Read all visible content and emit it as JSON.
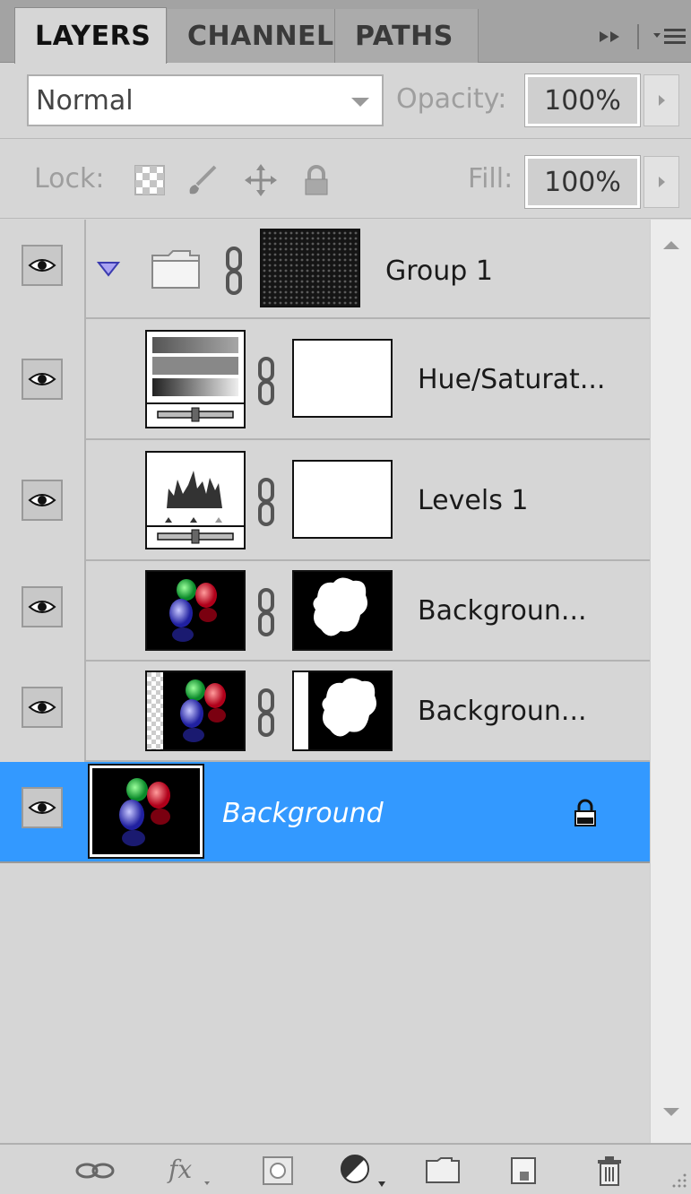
{
  "tabs": [
    {
      "label": "LAYERS",
      "active": true
    },
    {
      "label": "CHANNEL",
      "active": false
    },
    {
      "label": "PATHS",
      "active": false
    }
  ],
  "blend": {
    "mode": "Normal",
    "opacity_label": "Opacity:",
    "opacity_value": "100%"
  },
  "lock": {
    "label": "Lock:",
    "fill_label": "Fill:",
    "fill_value": "100%",
    "icons": [
      "transparency-lock-icon",
      "brush-lock-icon",
      "move-lock-icon",
      "padlock-icon"
    ]
  },
  "layers": [
    {
      "name": "Group 1",
      "type": "group",
      "expanded": true,
      "visible": true
    },
    {
      "name": "Hue/Saturat...",
      "type": "adjustment-hue-saturation",
      "visible": true
    },
    {
      "name": "Levels 1",
      "type": "adjustment-levels",
      "visible": true
    },
    {
      "name": "Backgroun...",
      "type": "pixel-with-mask",
      "visible": true
    },
    {
      "name": "Backgroun...",
      "type": "pixel-with-mask",
      "visible": true
    },
    {
      "name": "Background",
      "type": "background",
      "visible": true,
      "selected": true,
      "locked": true
    }
  ],
  "footer_icons": [
    "link-layers-icon",
    "fx-icon",
    "add-mask-icon",
    "adjustment-layer-icon",
    "new-group-icon",
    "new-layer-icon",
    "trash-icon"
  ],
  "colors": {
    "selection": "#3399ff",
    "panel": "#d6d6d6",
    "tabbar": "#a3a3a3"
  }
}
